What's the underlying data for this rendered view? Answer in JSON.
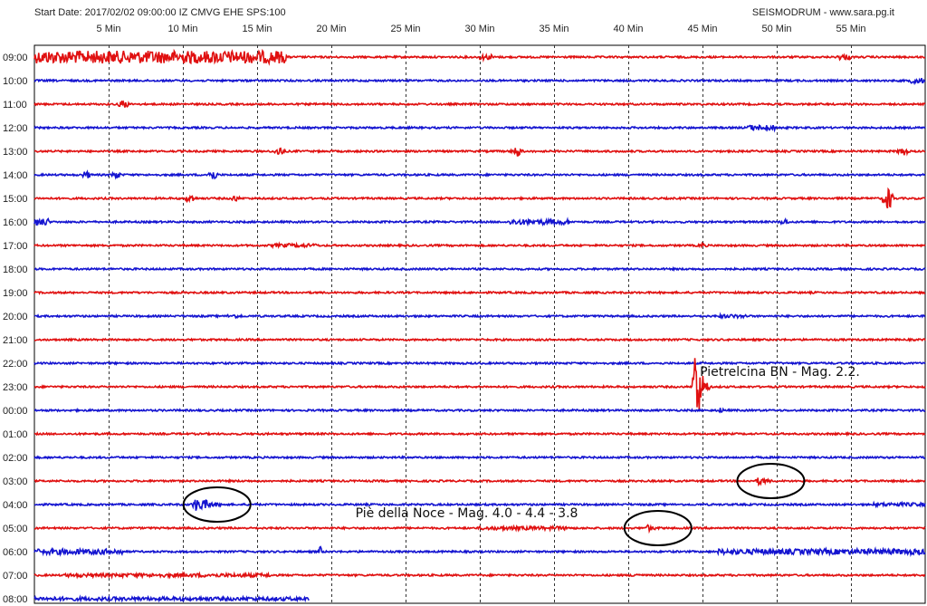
{
  "window": {
    "start_info": "Start Date: 2017/02/02 09:00:00 IZ CMVG EHE SPS:100",
    "brand": "SEISMODRUM - www.sara.pg.it"
  },
  "colors": {
    "red_trace": "#e01010",
    "blue_trace": "#1414d0",
    "grid": "#333333",
    "circle": "#000000"
  },
  "chart_data": {
    "type": "line",
    "title": "",
    "x_unit": "Min",
    "xlim": [
      0,
      60
    ],
    "x_ticks": [
      {
        "value": 5,
        "label": "5 Min"
      },
      {
        "value": 10,
        "label": "10 Min"
      },
      {
        "value": 15,
        "label": "15 Min"
      },
      {
        "value": 20,
        "label": "20 Min"
      },
      {
        "value": 25,
        "label": "25 Min"
      },
      {
        "value": 30,
        "label": "30 Min"
      },
      {
        "value": 35,
        "label": "35 Min"
      },
      {
        "value": 40,
        "label": "40 Min"
      },
      {
        "value": 45,
        "label": "45 Min"
      },
      {
        "value": 50,
        "label": "50 Min"
      },
      {
        "value": 55,
        "label": "55 Min"
      }
    ],
    "grid": true,
    "rows": [
      {
        "label": "09:00",
        "color": "red",
        "end_min": 60,
        "events": [
          {
            "start": 0,
            "end": 17,
            "amp": 7,
            "shape": "band"
          },
          {
            "start": 30,
            "end": 31,
            "amp": 3,
            "shape": "band"
          },
          {
            "start": 54,
            "end": 55,
            "amp": 3,
            "shape": "band"
          }
        ]
      },
      {
        "label": "10:00",
        "color": "blue",
        "end_min": 60,
        "events": [
          {
            "start": 59,
            "end": 60,
            "amp": 3,
            "shape": "band"
          }
        ]
      },
      {
        "label": "11:00",
        "color": "red",
        "end_min": 60,
        "events": [
          {
            "start": 5.5,
            "end": 6.5,
            "amp": 6,
            "shape": "spike"
          }
        ]
      },
      {
        "label": "12:00",
        "color": "blue",
        "end_min": 60,
        "events": [
          {
            "start": 48,
            "end": 50,
            "amp": 3,
            "shape": "band"
          }
        ]
      },
      {
        "label": "13:00",
        "color": "red",
        "end_min": 60,
        "events": [
          {
            "start": 16,
            "end": 17,
            "amp": 6,
            "shape": "spike"
          },
          {
            "start": 32,
            "end": 33,
            "amp": 7,
            "shape": "spike"
          },
          {
            "start": 58,
            "end": 59,
            "amp": 6,
            "shape": "spike"
          }
        ]
      },
      {
        "label": "14:00",
        "color": "blue",
        "end_min": 60,
        "events": [
          {
            "start": 3,
            "end": 4,
            "amp": 5,
            "shape": "spike"
          },
          {
            "start": 5,
            "end": 6,
            "amp": 5,
            "shape": "spike"
          },
          {
            "start": 11.5,
            "end": 12.5,
            "amp": 7,
            "shape": "spike"
          }
        ]
      },
      {
        "label": "15:00",
        "color": "red",
        "end_min": 60,
        "events": [
          {
            "start": 10,
            "end": 11,
            "amp": 6,
            "shape": "spike"
          },
          {
            "start": 13,
            "end": 14,
            "amp": 4,
            "shape": "spike"
          },
          {
            "start": 57,
            "end": 58,
            "amp": 14,
            "shape": "spike"
          }
        ]
      },
      {
        "label": "16:00",
        "color": "blue",
        "end_min": 60,
        "events": [
          {
            "start": 0,
            "end": 1,
            "amp": 4,
            "shape": "band"
          },
          {
            "start": 32,
            "end": 36,
            "amp": 3,
            "shape": "band"
          },
          {
            "start": 50,
            "end": 51,
            "amp": 4,
            "shape": "spike"
          }
        ]
      },
      {
        "label": "17:00",
        "color": "red",
        "end_min": 60,
        "events": [
          {
            "start": 16,
            "end": 19,
            "amp": 2,
            "shape": "band"
          },
          {
            "start": 44.5,
            "end": 45.5,
            "amp": 3,
            "shape": "spike"
          }
        ]
      },
      {
        "label": "18:00",
        "color": "blue",
        "end_min": 60,
        "events": []
      },
      {
        "label": "19:00",
        "color": "red",
        "end_min": 60,
        "events": []
      },
      {
        "label": "20:00",
        "color": "blue",
        "end_min": 60,
        "events": [
          {
            "start": 13,
            "end": 14,
            "amp": 2,
            "shape": "band"
          },
          {
            "start": 46,
            "end": 48,
            "amp": 2,
            "shape": "band"
          }
        ]
      },
      {
        "label": "21:00",
        "color": "red",
        "end_min": 60,
        "events": []
      },
      {
        "label": "22:00",
        "color": "blue",
        "end_min": 60,
        "events": []
      },
      {
        "label": "23:00",
        "color": "red",
        "end_min": 60,
        "events": [
          {
            "start": 44.3,
            "end": 45.5,
            "amp": 58,
            "shape": "quake"
          }
        ]
      },
      {
        "label": "00:00",
        "color": "blue",
        "end_min": 60,
        "events": [
          {
            "start": 46,
            "end": 46.5,
            "amp": 4,
            "shape": "spike"
          }
        ]
      },
      {
        "label": "01:00",
        "color": "red",
        "end_min": 60,
        "events": []
      },
      {
        "label": "02:00",
        "color": "blue",
        "end_min": 60,
        "events": []
      },
      {
        "label": "03:00",
        "color": "red",
        "end_min": 60,
        "events": [
          {
            "start": 48.5,
            "end": 50.5,
            "amp": 5,
            "shape": "quake"
          }
        ]
      },
      {
        "label": "04:00",
        "color": "blue",
        "end_min": 60,
        "events": [
          {
            "start": 10.5,
            "end": 13.5,
            "amp": 9,
            "shape": "quake"
          },
          {
            "start": 56.5,
            "end": 60,
            "amp": 2,
            "shape": "band"
          }
        ]
      },
      {
        "label": "05:00",
        "color": "red",
        "end_min": 60,
        "events": [
          {
            "start": 30,
            "end": 36,
            "amp": 2,
            "shape": "band"
          },
          {
            "start": 41,
            "end": 43,
            "amp": 4,
            "shape": "quake"
          }
        ]
      },
      {
        "label": "06:00",
        "color": "blue",
        "end_min": 60,
        "events": [
          {
            "start": 0,
            "end": 6,
            "amp": 3,
            "shape": "band"
          },
          {
            "start": 19,
            "end": 19.5,
            "amp": 6,
            "shape": "spike"
          },
          {
            "start": 46,
            "end": 60,
            "amp": 3,
            "shape": "band"
          }
        ]
      },
      {
        "label": "07:00",
        "color": "red",
        "end_min": 60,
        "events": [
          {
            "start": 2,
            "end": 16,
            "amp": 2,
            "shape": "band"
          },
          {
            "start": 40,
            "end": 41,
            "amp": 3,
            "shape": "spike"
          }
        ]
      },
      {
        "label": "08:00",
        "color": "blue",
        "end_min": 18.5,
        "events": [
          {
            "start": 0,
            "end": 18.5,
            "amp": 2,
            "shape": "band"
          }
        ]
      }
    ],
    "annotations": [
      {
        "text": "Pietrelcina BN - Mag. 2.2.",
        "row": "22:00",
        "minute": 44.7
      },
      {
        "text": "Piè della Noce -  Mag. 4.0 - 4.4 - 3.8",
        "row": "04:00",
        "minute": 21.5
      }
    ],
    "circled_events": [
      {
        "row": "04:00",
        "center_min": 12.3
      },
      {
        "row": "03:00",
        "center_min": 49.6
      },
      {
        "row": "05:00",
        "center_min": 42.0
      }
    ]
  }
}
